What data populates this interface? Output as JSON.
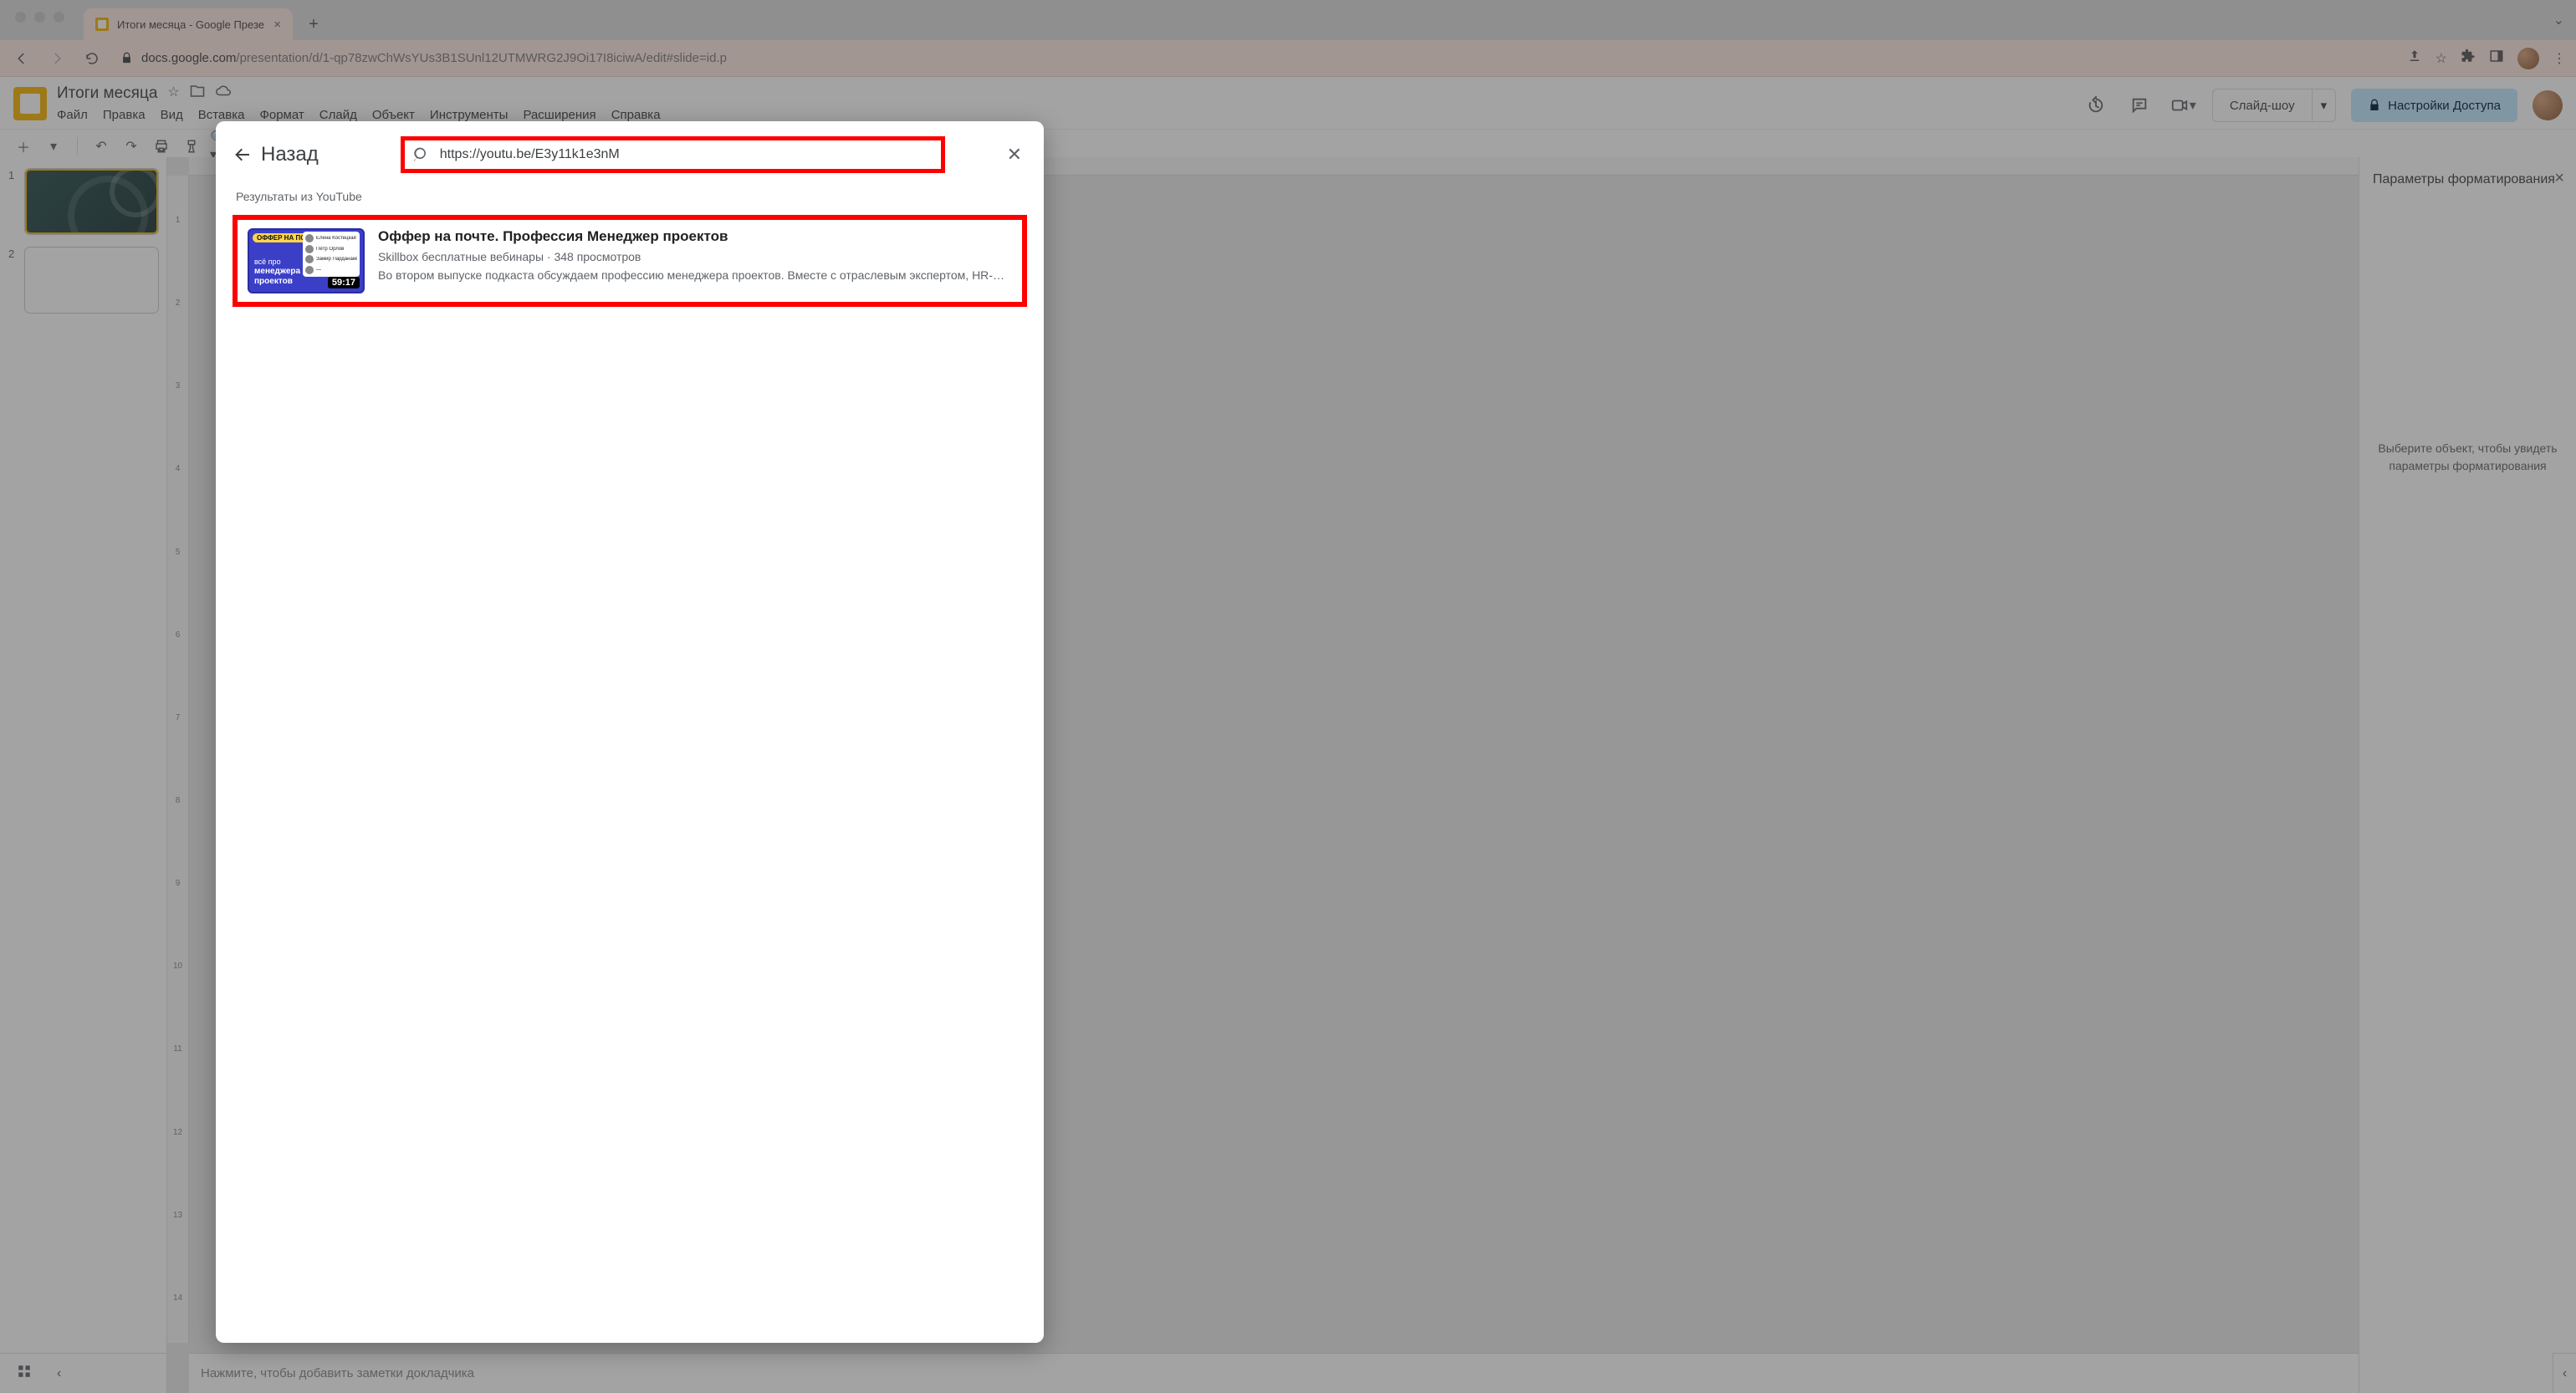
{
  "browser": {
    "tab_title": "Итоги месяца - Google Презе",
    "url_host": "docs.google.com",
    "url_path": "/presentation/d/1-qp78zwChWsYUs3B1SUnl12UTMWRG2J9Oi17I8iciwA/edit#slide=id.p"
  },
  "header": {
    "doc_title": "Итоги месяца",
    "menus": [
      "Файл",
      "Правка",
      "Вид",
      "Вставка",
      "Формат",
      "Слайд",
      "Объект",
      "Инструменты",
      "Расширения",
      "Справка"
    ],
    "slideshow": "Слайд-шоу",
    "share": "Настройки Доступа"
  },
  "sidepanel": {
    "title": "Параметры форматирования",
    "hint": "Выберите объект, чтобы увидеть параметры форматирования"
  },
  "ruler_v": [
    "1",
    "2",
    "3",
    "4",
    "5",
    "6",
    "7",
    "8",
    "9",
    "10",
    "11",
    "12",
    "13",
    "14"
  ],
  "filmstrip": {
    "slides": [
      "1",
      "2"
    ]
  },
  "notes_placeholder": "Нажмите, чтобы добавить заметки докладчика",
  "modal": {
    "back": "Назад",
    "search_value": "https://youtu.be/E3y11k1e3nM",
    "results_label": "Результаты из YouTube",
    "result": {
      "title": "Оффер на почте. Профессия Менеджер проектов",
      "meta": "Skillbox бесплатные вебинары · 348 просмотров",
      "desc": "Во втором выпуске подкаста обсуждаем профессию менеджера проектов. Вместе с отраслевым экспертом, HR-…",
      "tag": "ОФФЕР НА ПОЧТЕ",
      "duration": "59:17",
      "thumb_line1": "всё про",
      "thumb_line2": "менеджера",
      "thumb_line3": "проектов",
      "people": [
        "Елена Костецкая",
        "Пётр Орлов",
        "Замир Парданаев",
        "—"
      ]
    }
  }
}
